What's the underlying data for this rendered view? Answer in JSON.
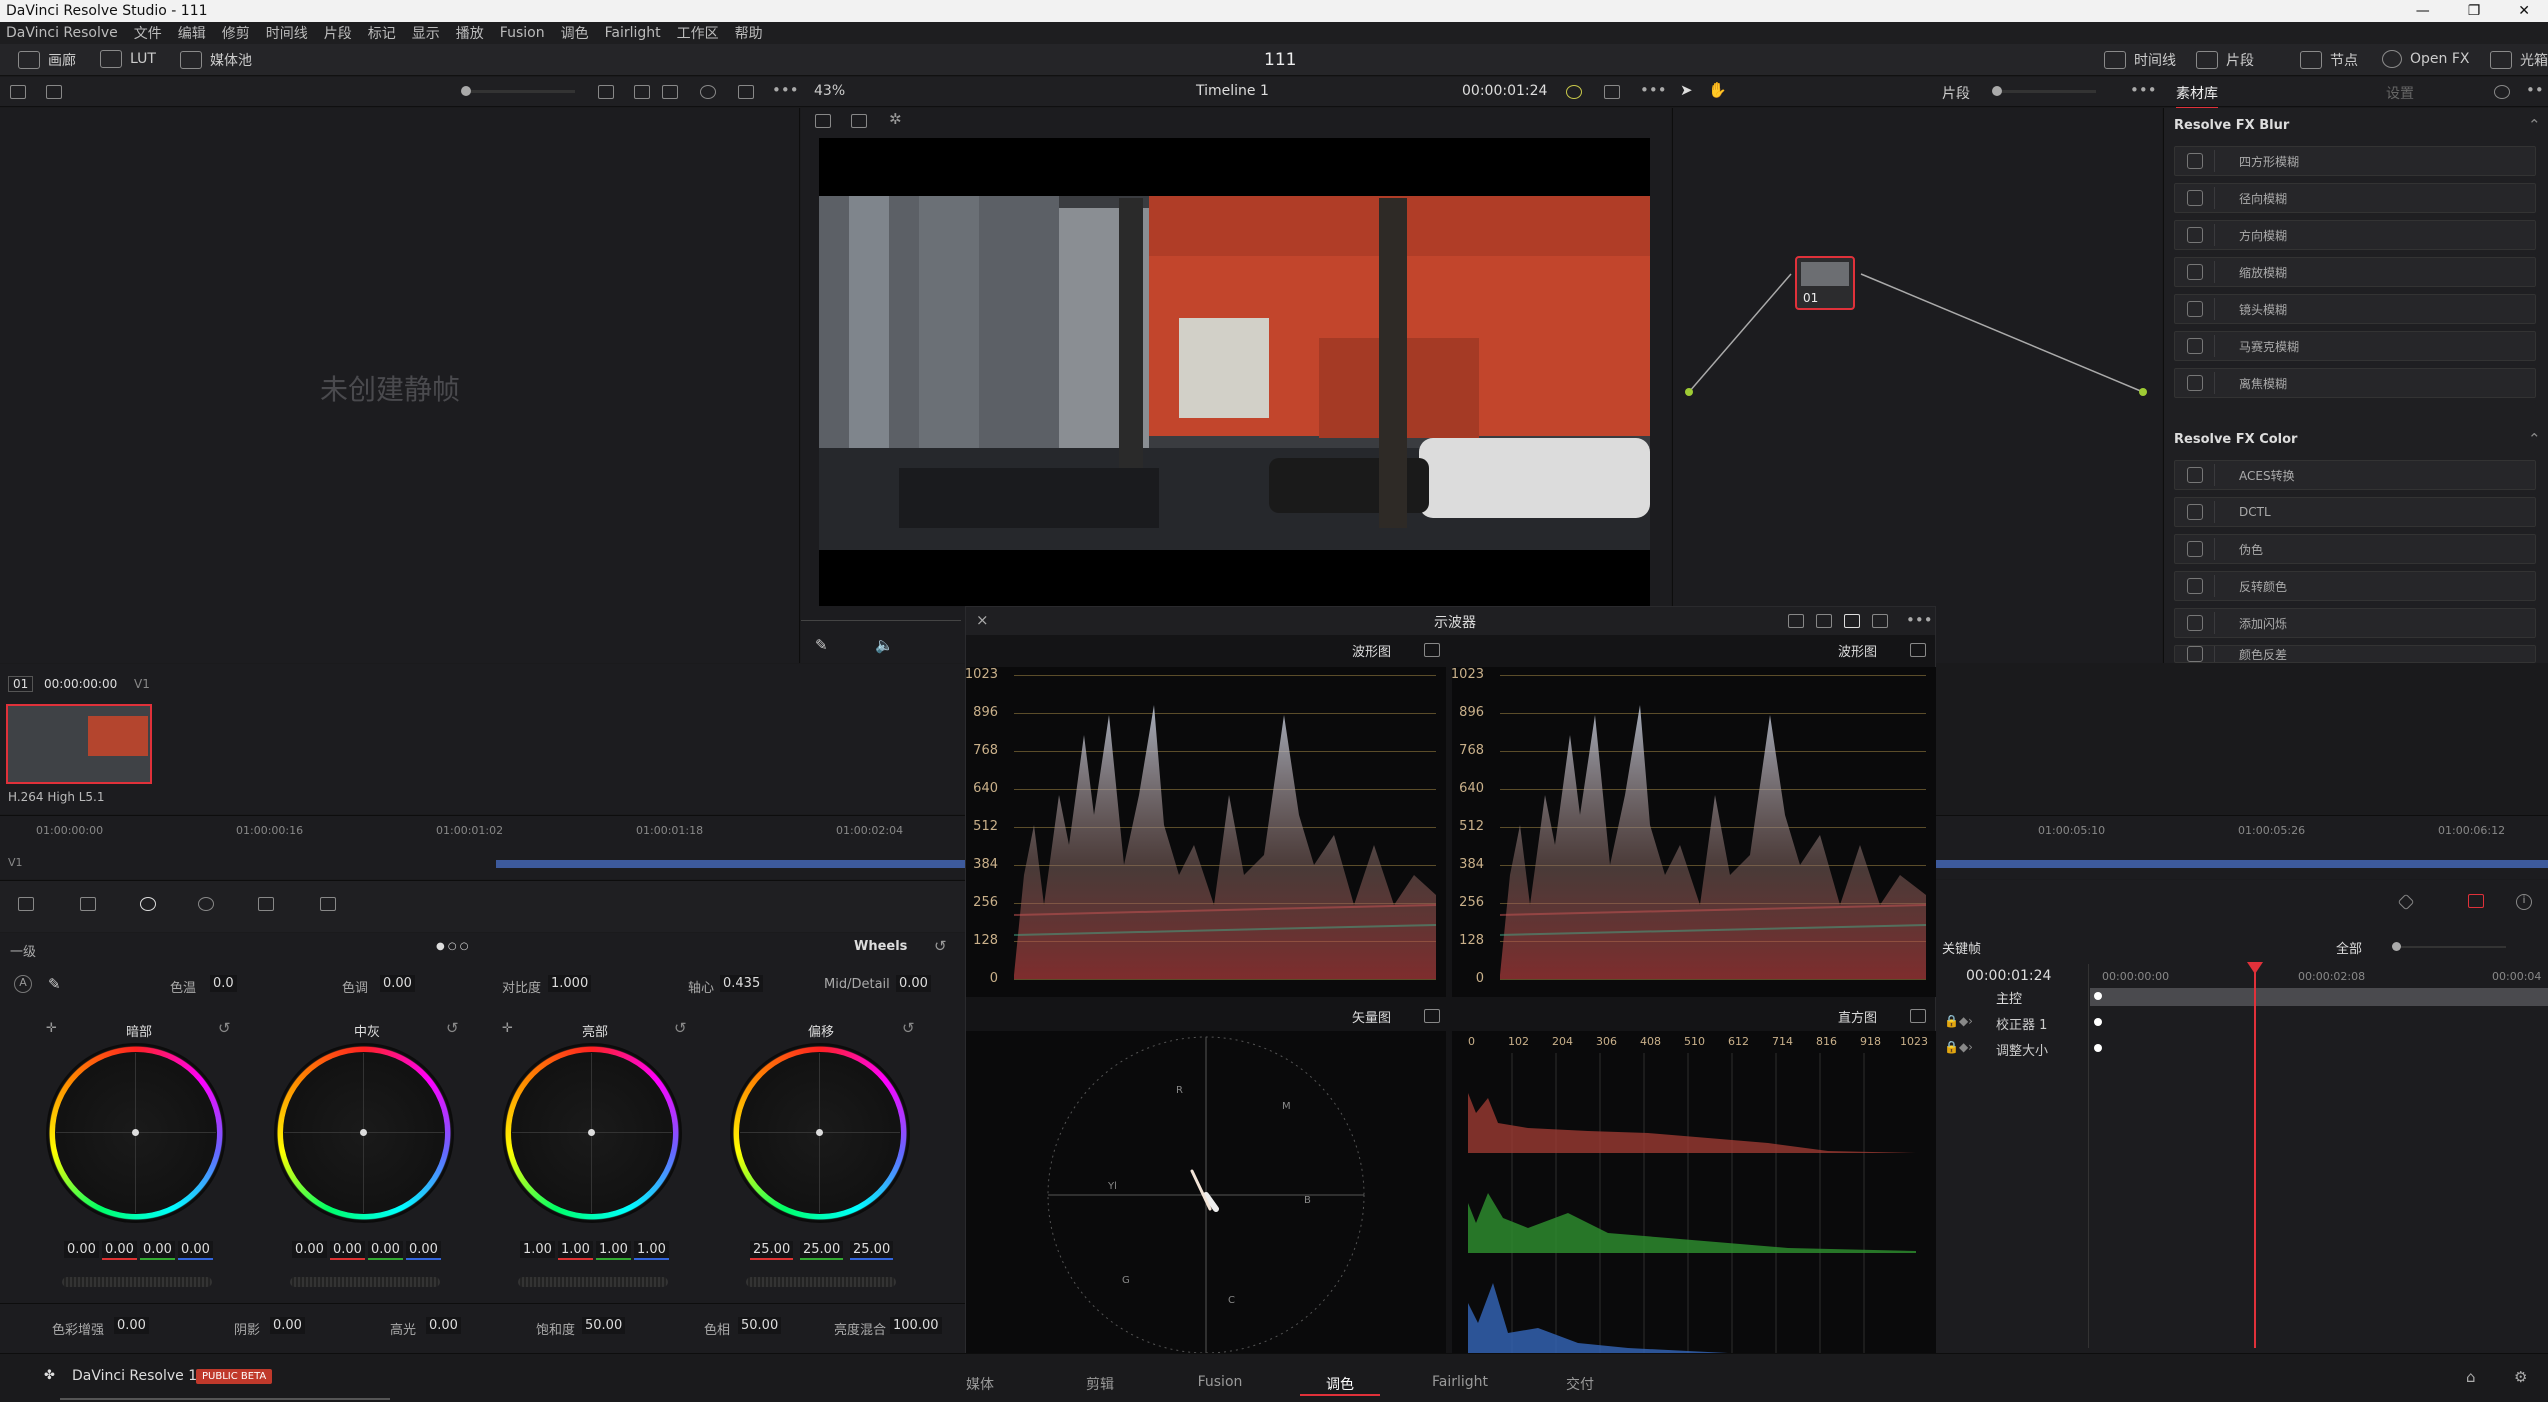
{
  "window": {
    "title": "DaVinci Resolve Studio - 111"
  },
  "menu": [
    "DaVinci Resolve",
    "文件",
    "编辑",
    "修剪",
    "时间线",
    "片段",
    "标记",
    "显示",
    "播放",
    "Fusion",
    "调色",
    "Fairlight",
    "工作区",
    "帮助"
  ],
  "toolbar": {
    "gallery": "画廊",
    "lut": "LUT",
    "media_pool": "媒体池",
    "project_name": "111",
    "timeline": "时间线",
    "clips": "片段",
    "nodes": "节点",
    "open_fx": "Open FX",
    "lightbox": "光箱"
  },
  "viewer": {
    "zoom": "43%",
    "timeline_name": "Timeline 1",
    "timecode": "00:00:01:24"
  },
  "gallery": {
    "empty_text": "未创建静帧"
  },
  "nodes": {
    "clip_mode": "片段",
    "node_label": "01"
  },
  "library": {
    "tab_library": "素材库",
    "tab_settings": "设置",
    "sections": [
      {
        "title": "Resolve FX Blur",
        "items": [
          "四方形模糊",
          "径向模糊",
          "方向模糊",
          "缩放模糊",
          "镜头模糊",
          "马赛克模糊",
          "离焦模糊"
        ]
      },
      {
        "title": "Resolve FX Color",
        "items": [
          "ACES转换",
          "DCTL",
          "伪色",
          "反转颜色",
          "添加闪烁",
          "颜色反差"
        ]
      }
    ]
  },
  "clip": {
    "number": "01",
    "timecode": "00:00:00:00",
    "track": "V1",
    "codec": "H.264 High L5.1"
  },
  "timeline_ruler": [
    "01:00:00:00",
    "01:00:00:16",
    "01:00:01:02",
    "01:00:01:18",
    "01:00:02:04",
    "01:00:05:10",
    "01:00:05:26",
    "01:00:06:12"
  ],
  "track_label": "V1",
  "scopes": {
    "title": "示波器",
    "top_left_mode": "波形图",
    "top_right_mode": "波形图",
    "bottom_left_mode": "矢量图",
    "bottom_right_mode": "直方图",
    "waveform_axis": [
      "1023",
      "896",
      "768",
      "640",
      "512",
      "384",
      "256",
      "128",
      "0"
    ],
    "histogram_axis": [
      "0",
      "102",
      "204",
      "306",
      "408",
      "510",
      "612",
      "714",
      "816",
      "918",
      "1023"
    ],
    "vector_targets": [
      "R",
      "M",
      "B",
      "C",
      "G",
      "Yl"
    ]
  },
  "wheels": {
    "section_label": "一级",
    "mode": "Wheels",
    "top_params": [
      {
        "label": "色温",
        "value": "0.0"
      },
      {
        "label": "色调",
        "value": "0.00"
      },
      {
        "label": "对比度",
        "value": "1.000"
      },
      {
        "label": "轴心",
        "value": "0.435"
      },
      {
        "label": "Mid/Detail",
        "value": "0.00"
      }
    ],
    "wheels": [
      {
        "label": "暗部",
        "values": [
          "0.00",
          "0.00",
          "0.00",
          "0.00"
        ]
      },
      {
        "label": "中灰",
        "values": [
          "0.00",
          "0.00",
          "0.00",
          "0.00"
        ]
      },
      {
        "label": "亮部",
        "values": [
          "1.00",
          "1.00",
          "1.00",
          "1.00"
        ]
      },
      {
        "label": "偏移",
        "values": [
          "25.00",
          "25.00",
          "25.00"
        ]
      }
    ],
    "bottom_params": [
      {
        "label": "色彩增强",
        "value": "0.00"
      },
      {
        "label": "阴影",
        "value": "0.00"
      },
      {
        "label": "高光",
        "value": "0.00"
      },
      {
        "label": "饱和度",
        "value": "50.00"
      },
      {
        "label": "色相",
        "value": "50.00"
      },
      {
        "label": "亮度混合",
        "value": "100.00"
      }
    ]
  },
  "keyframes": {
    "title": "关键帧",
    "filter": "全部",
    "timecode": "00:00:01:24",
    "ruler": [
      "00:00:00:00",
      "00:00:02:08",
      "00:00:04"
    ],
    "rows": [
      "主控",
      "校正器 1",
      "调整大小"
    ]
  },
  "bottom": {
    "app_name": "DaVinci Resolve 17",
    "badge": "PUBLIC BETA",
    "pages": [
      "媒体",
      "剪辑",
      "Fusion",
      "调色",
      "Fairlight",
      "交付"
    ],
    "active_page": "调色"
  },
  "colors": {
    "accent": "#e0313a",
    "bg": "#1c1c1f"
  }
}
